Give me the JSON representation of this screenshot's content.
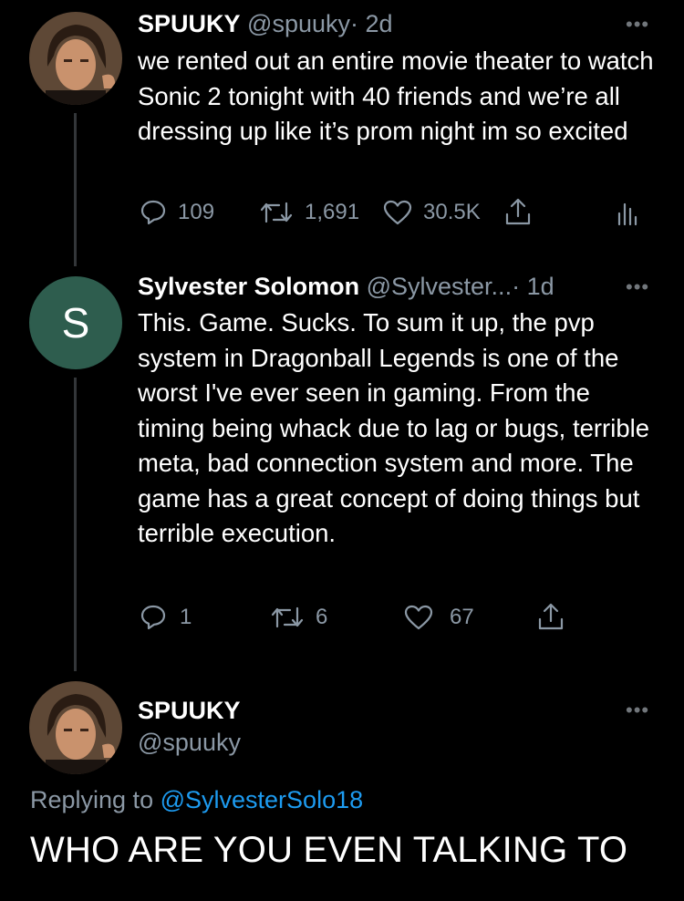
{
  "tweets": [
    {
      "name": "SPUUKY",
      "handle": "@spuuky",
      "time": "· 2d",
      "text": "we rented out an entire movie theater to watch Sonic 2 tonight with 40 friends and we’re all dressing up like it’s prom night im so excited",
      "replies": "109",
      "retweets": "1,691",
      "likes": "30.5K"
    },
    {
      "name": "Sylvester Solomon",
      "handle": "@Sylvester...",
      "time": "· 1d",
      "avatar_letter": "S",
      "text": "This. Game. Sucks. To sum it up, the pvp system in Dragonball Legends is one of the worst I've ever seen in gaming. From the timing being whack due to lag or bugs, terrible meta, bad connection system and more. The game has a great concept of doing things but terrible execution.",
      "replies": "1",
      "retweets": "6",
      "likes": "67"
    }
  ],
  "main_tweet": {
    "name": "SPUUKY",
    "handle": "@spuuky",
    "replying_prefix": "Replying to",
    "replying_to": "@SylvesterSolo18",
    "text": "WHO ARE YOU EVEN TALKING TO"
  },
  "more_glyph": "•••",
  "colors": {
    "background": "#000000",
    "secondary_text": "#8b98a5",
    "link": "#1d9bf0",
    "avatar_s": "#2e5d4e"
  }
}
